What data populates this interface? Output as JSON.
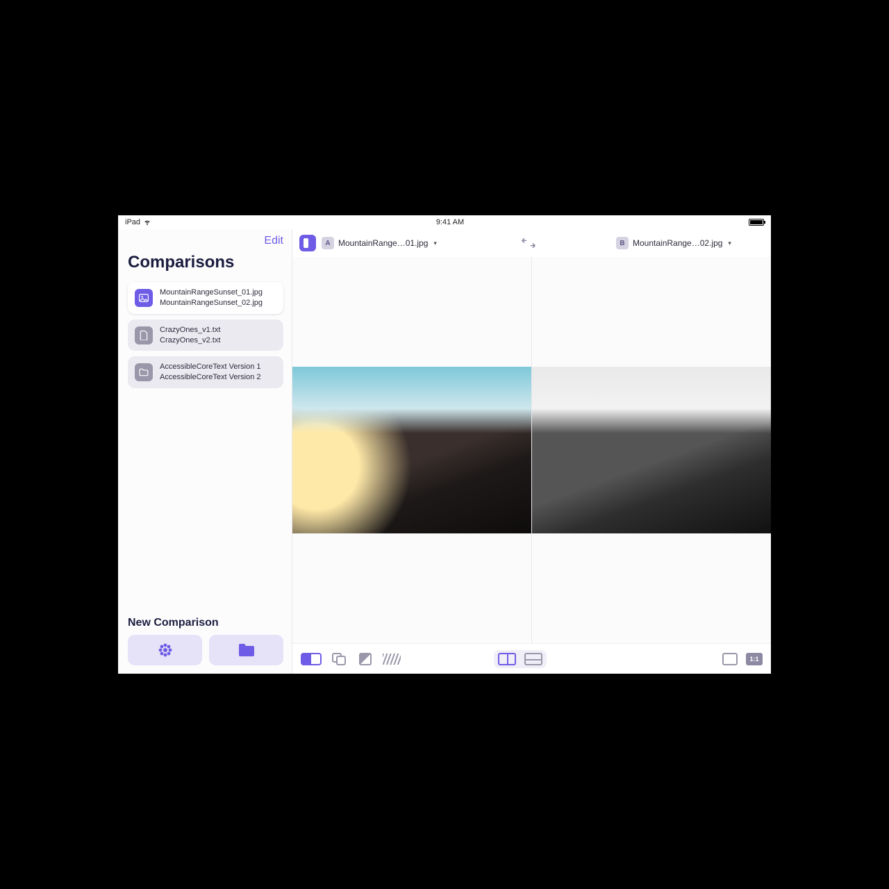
{
  "statusbar": {
    "device": "iPad",
    "time": "9:41 AM"
  },
  "sidebar": {
    "edit_label": "Edit",
    "title": "Comparisons",
    "items": [
      {
        "icon": "image-icon",
        "line1": "MountainRangeSunset_01.jpg",
        "line2": "MountainRangeSunset_02.jpg",
        "active": true,
        "icon_color": "purple"
      },
      {
        "icon": "text-file-icon",
        "line1": "CrazyOnes_v1.txt",
        "line2": "CrazyOnes_v2.txt",
        "active": false,
        "icon_color": "grey"
      },
      {
        "icon": "folder-icon",
        "line1": "AccessibleCoreText Version 1",
        "line2": "AccessibleCoreText Version 2",
        "active": false,
        "icon_color": "grey"
      }
    ],
    "new_comparison_label": "New Comparison"
  },
  "topbar": {
    "file_a": {
      "badge": "A",
      "name": "MountainRange…01.jpg"
    },
    "file_b": {
      "badge": "B",
      "name": "MountainRange…02.jpg"
    }
  },
  "bottombar": {
    "actual_size_label": "1:1"
  },
  "colors": {
    "accent": "#6e5ce6"
  }
}
